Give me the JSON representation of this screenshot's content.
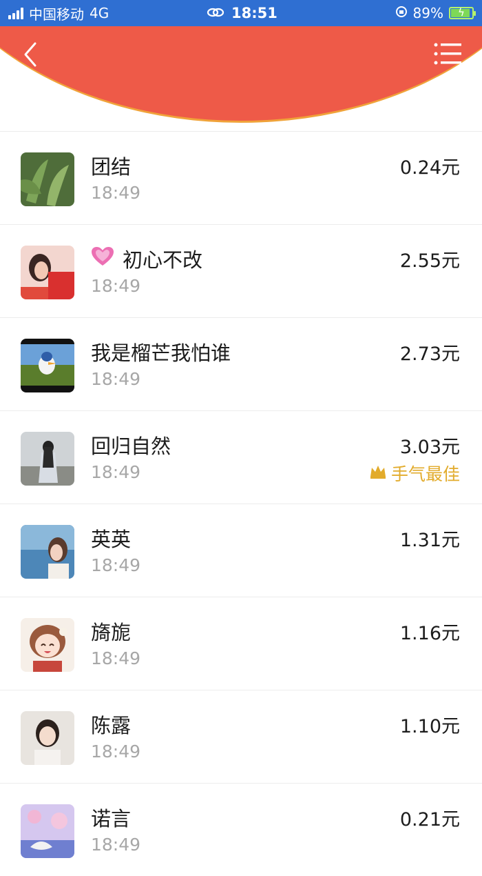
{
  "status_bar": {
    "carrier": "中国移动",
    "network": "4G",
    "time": "18:51",
    "battery": "89%"
  },
  "header": {
    "accent_color": "#ee5a48",
    "back_icon": "chevron-left-icon",
    "menu_icon": "menu-list-icon"
  },
  "records": [
    {
      "name": "团结",
      "time": "18:49",
      "amount": "0.24元"
    },
    {
      "name": "初心不改",
      "time": "18:49",
      "amount": "2.55元",
      "name_prefix_icon": "heart-icon"
    },
    {
      "name": "我是榴芒我怕谁",
      "time": "18:49",
      "amount": "2.73元"
    },
    {
      "name": "回归自然",
      "time": "18:49",
      "amount": "3.03元",
      "badge": "手气最佳"
    },
    {
      "name": "英英",
      "time": "18:49",
      "amount": "1.31元"
    },
    {
      "name": "旖旎",
      "time": "18:49",
      "amount": "1.16元"
    },
    {
      "name": "陈露",
      "time": "18:49",
      "amount": "1.10元"
    },
    {
      "name": "诺言",
      "time": "18:49",
      "amount": "0.21元"
    }
  ]
}
